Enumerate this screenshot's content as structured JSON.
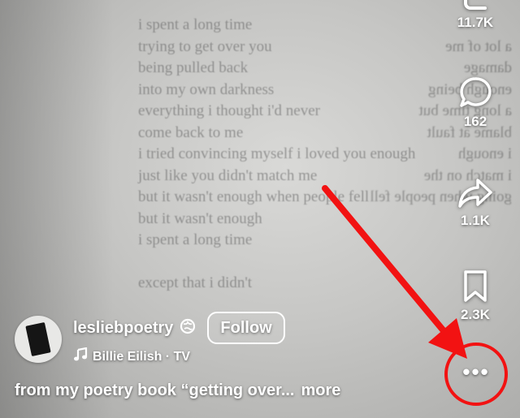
{
  "background_poem": {
    "lines": [
      "i spent a long time",
      "trying to get over you",
      "being pulled back",
      "into my own darkness",
      "everything i thought i'd never",
      "come back to me",
      "i tried convincing myself i loved you enough",
      "just like you didn't match me",
      "but it wasn't enough when people fell",
      "but it wasn't enough",
      "i spent a long time",
      "",
      "except that i didn't"
    ],
    "bleed_through": [
      "",
      "a lot of me",
      "damage",
      "enough being",
      "a long time but",
      "blame at fault",
      "i enough",
      "i match on the",
      "going when people fell"
    ]
  },
  "actions": {
    "share_count": "11.7K",
    "comments_count": "162",
    "reposts_count": "1.1K",
    "saves_count": "2.3K",
    "more_label": "•••"
  },
  "author": {
    "username": "lesliebpoetry",
    "follow_label": "Follow",
    "sound": "Billie Eilish · TV"
  },
  "caption": {
    "text": "from my poetry book “getting over...",
    "more_label": "more"
  },
  "colors": {
    "annotation_red": "#f21212"
  }
}
